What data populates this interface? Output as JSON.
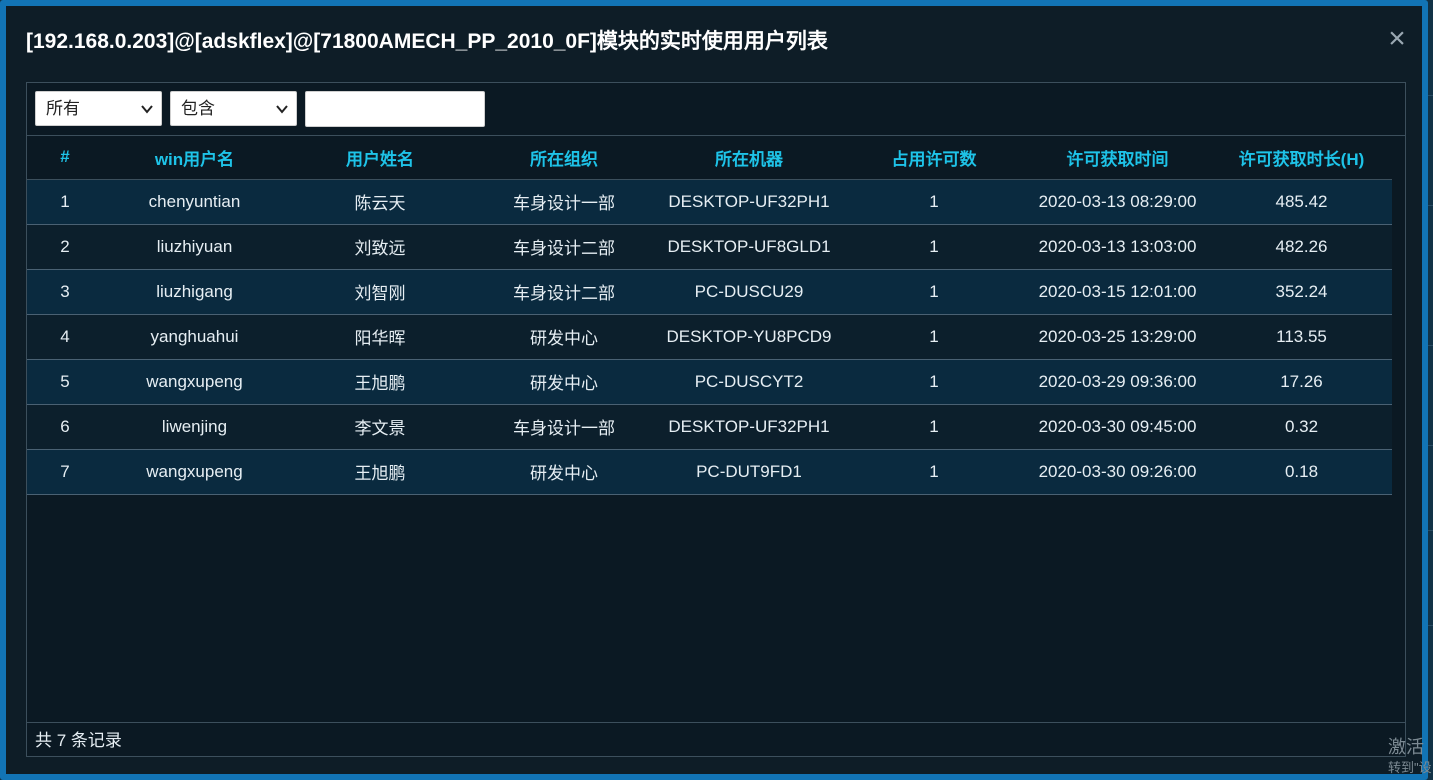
{
  "dialog": {
    "title": "[192.168.0.203]@[adskflex]@[71800AMECH_PP_2010_0F]模块的实时使用用户列表",
    "close_symbol": "×"
  },
  "filters": {
    "scope_value": "所有",
    "match_value": "包含",
    "search_value": ""
  },
  "table": {
    "headers": [
      "#",
      "win用户名",
      "用户姓名",
      "所在组织",
      "所在机器",
      "占用许可数",
      "许可获取时间",
      "许可获取时长(H)"
    ],
    "rows": [
      [
        "1",
        "chenyuntian",
        "陈云天",
        "车身设计一部",
        "DESKTOP-UF32PH1",
        "1",
        "2020-03-13 08:29:00",
        "485.42"
      ],
      [
        "2",
        "liuzhiyuan",
        "刘致远",
        "车身设计二部",
        "DESKTOP-UF8GLD1",
        "1",
        "2020-03-13 13:03:00",
        "482.26"
      ],
      [
        "3",
        "liuzhigang",
        "刘智刚",
        "车身设计二部",
        "PC-DUSCU29",
        "1",
        "2020-03-15 12:01:00",
        "352.24"
      ],
      [
        "4",
        "yanghuahui",
        "阳华晖",
        "研发中心",
        "DESKTOP-YU8PCD9",
        "1",
        "2020-03-25 13:29:00",
        "113.55"
      ],
      [
        "5",
        "wangxupeng",
        "王旭鹏",
        "研发中心",
        "PC-DUSCYT2",
        "1",
        "2020-03-29 09:36:00",
        "17.26"
      ],
      [
        "6",
        "liwenjing",
        "李文景",
        "车身设计一部",
        "DESKTOP-UF32PH1",
        "1",
        "2020-03-30 09:45:00",
        "0.32"
      ],
      [
        "7",
        "wangxupeng",
        "王旭鹏",
        "研发中心",
        "PC-DUT9FD1",
        "1",
        "2020-03-30 09:26:00",
        "0.18"
      ]
    ]
  },
  "footer": {
    "record_count_text": "共 7 条记录"
  },
  "os_watermark": {
    "line1": "激活",
    "line2": "转到\"设"
  },
  "colors": {
    "header_text": "#1ec3e8",
    "dialog_border": "#1274b5",
    "row_alt": "#0a2a3f"
  }
}
